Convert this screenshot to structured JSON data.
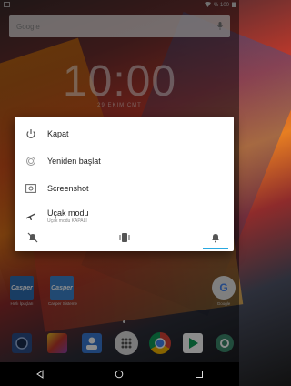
{
  "status_bar": {
    "battery_text": "% 100"
  },
  "search_bar": {
    "logo_text": "Google"
  },
  "lockclock": {
    "time": "10:00",
    "date": "29 EKIM CMT"
  },
  "power_menu": {
    "items": [
      {
        "label": "Kapat",
        "icon": "power-icon"
      },
      {
        "label": "Yeniden başlat",
        "icon": "restart-icon"
      },
      {
        "label": "Screenshot",
        "icon": "screenshot-icon"
      },
      {
        "label": "Uçak modu",
        "sublabel": "Uçak modu KAPALI",
        "icon": "airplane-icon"
      }
    ],
    "sound_modes": [
      {
        "name": "silent",
        "icon": "mute-bell-icon"
      },
      {
        "name": "vibrate",
        "icon": "vibrate-icon"
      },
      {
        "name": "sound",
        "icon": "bell-icon",
        "active": true
      }
    ],
    "accent_color": "#29a8e0"
  },
  "home_apps": [
    {
      "label": "Hızlı İpuçları",
      "tile_text": "Casper",
      "color": "#2f6fb5"
    },
    {
      "label": "Casper Sisteme",
      "tile_text": "Casper",
      "color": "#3d86cf"
    },
    {
      "label": "Google",
      "tile_text": "G",
      "color": "#e8e8e8"
    }
  ],
  "dock_apps": [
    "camera",
    "gallery",
    "contacts",
    "app-drawer",
    "chrome",
    "play-store",
    "settings"
  ]
}
